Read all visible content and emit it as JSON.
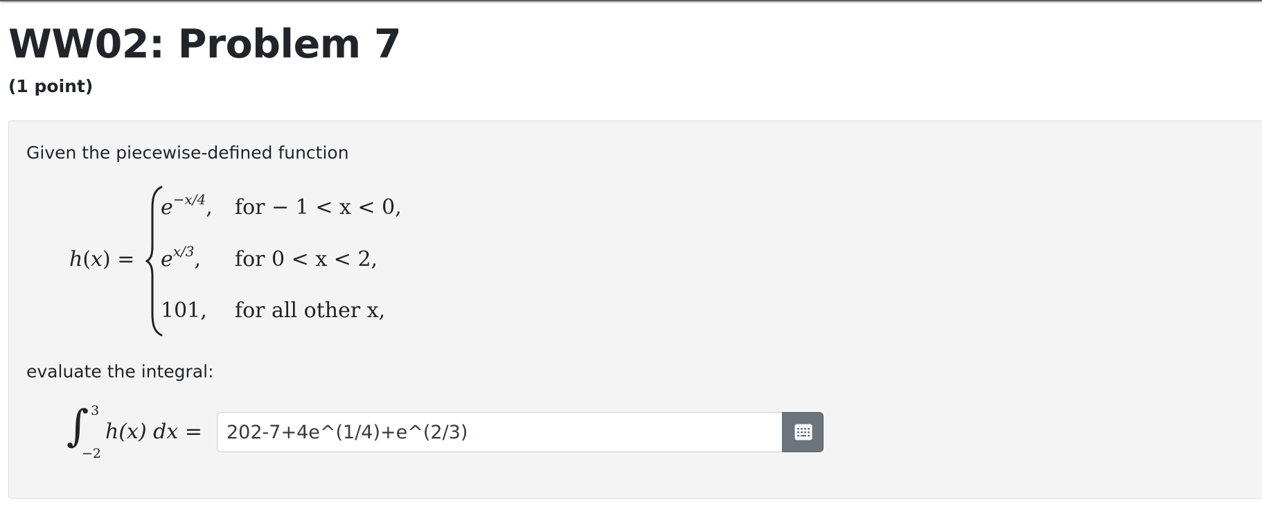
{
  "header": {
    "title": "WW02: Problem 7",
    "points": "(1 point)"
  },
  "problem": {
    "intro": "Given the piecewise-defined function",
    "function_lhs": "h(x) =",
    "pieces": [
      {
        "value": "e",
        "exponent": "−x/4",
        "comma": ",",
        "condition": "for  − 1 < x < 0,"
      },
      {
        "value": "e",
        "exponent": "x/3",
        "comma": ",",
        "condition": "for 0 < x < 2,"
      },
      {
        "value": "101,",
        "exponent": "",
        "comma": "",
        "condition": "for all other x,"
      }
    ],
    "instruction": "evaluate the integral:",
    "integral": {
      "symbol": "∫",
      "upper_limit": "3",
      "lower_limit": "−2",
      "integrand": "h(x) dx =",
      "answer_value": "202-7+4e^(1/4)+e^(2/3)",
      "equation_editor_icon": "keypad-icon"
    }
  }
}
